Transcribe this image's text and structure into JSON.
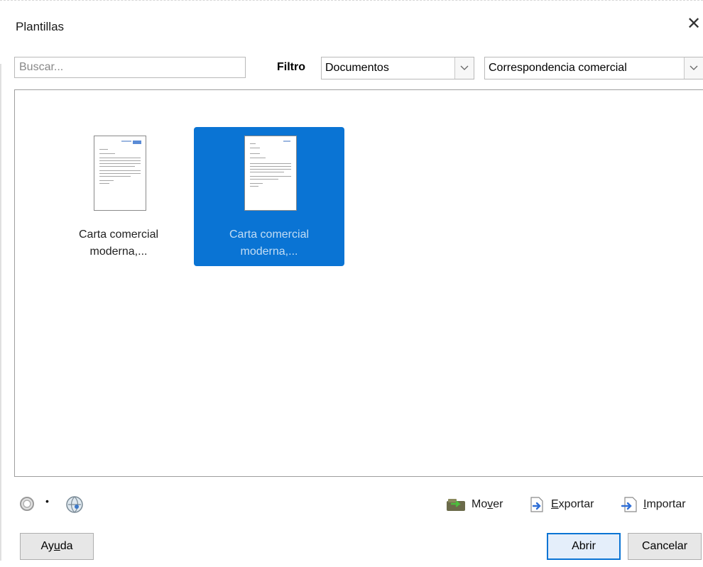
{
  "dialog": {
    "title": "Plantillas",
    "close_glyph": "✕"
  },
  "search": {
    "placeholder": "Buscar...",
    "value": ""
  },
  "filter": {
    "label": "Filtro",
    "type_selected": "Documentos",
    "category_selected": "Correspondencia comercial"
  },
  "templates": [
    {
      "line1": "Carta comercial",
      "line2": "moderna,...",
      "selected": false
    },
    {
      "line1": "Carta comercial",
      "line2": "moderna,...",
      "selected": true
    }
  ],
  "bottom_actions": {
    "settings_icon": "gear-icon",
    "repository_icon": "globe-icon",
    "move": {
      "pre": "Mo",
      "mnemonic": "v",
      "post": "er"
    },
    "export": {
      "pre": "",
      "mnemonic": "E",
      "post": "xportar"
    },
    "import": {
      "pre": "",
      "mnemonic": "I",
      "post": "mportar"
    }
  },
  "buttons": {
    "help": {
      "pre": "Ay",
      "mnemonic": "u",
      "post": "da"
    },
    "open": "Abrir",
    "cancel": "Cancelar"
  },
  "colors": {
    "selection": "#0a74d4",
    "default_button_border": "#0a74d4"
  }
}
